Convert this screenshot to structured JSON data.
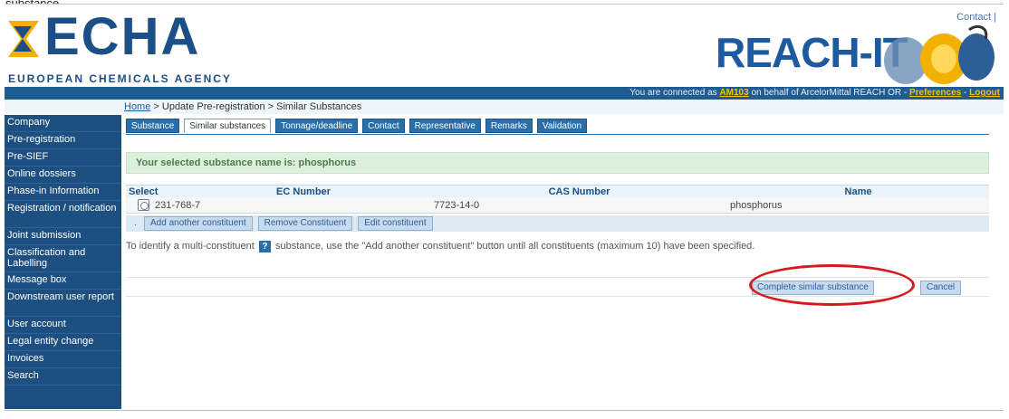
{
  "page_caption": "substance",
  "header": {
    "logo_text": "ECHA",
    "logo_subtitle": "EUROPEAN CHEMICALS AGENCY",
    "app_name": "REACH-IT",
    "contact_label": "Contact |"
  },
  "status_bar": {
    "prefix": "You are connected as ",
    "user": "AM103",
    "middle": " on behalf of ArcelorMittal REACH OR - ",
    "preferences": "Preferences",
    "separator": " - ",
    "logout": "Logout"
  },
  "breadcrumb": {
    "home": "Home",
    "rest": " > Update Pre-registration > Similar Substances"
  },
  "sidebar": {
    "items": [
      {
        "label": "Company"
      },
      {
        "label": "Pre-registration"
      },
      {
        "label": "Pre-SIEF"
      },
      {
        "label": "Online dossiers"
      },
      {
        "label": "Phase-in Information"
      },
      {
        "label": "Registration / notification"
      },
      {
        "label": "Joint submission"
      },
      {
        "label": "Classification and Labelling"
      },
      {
        "label": "Message box"
      },
      {
        "label": "Downstream user report"
      },
      {
        "label": "User account"
      },
      {
        "label": "Legal entity change"
      },
      {
        "label": "Invoices"
      },
      {
        "label": "Search"
      }
    ]
  },
  "tabs": [
    {
      "label": "Substance"
    },
    {
      "label": "Similar substances"
    },
    {
      "label": "Tonnage/deadline"
    },
    {
      "label": "Contact"
    },
    {
      "label": "Representative"
    },
    {
      "label": "Remarks"
    },
    {
      "label": "Validation"
    }
  ],
  "selected_banner": "Your selected substance name is: phosphorus",
  "grid": {
    "headers": {
      "select": "Select",
      "ec": "EC Number",
      "cas": "CAS Number",
      "name": "Name"
    },
    "rows": [
      {
        "ec": "231-768-7",
        "cas": "7723-14-0",
        "name": "phosphorus"
      }
    ]
  },
  "constituent_actions": {
    "bullet": ".",
    "add": "Add another constituent",
    "remove": "Remove Constituent",
    "edit": "Edit constituent"
  },
  "help": {
    "before": "To identify a multi-constituent ",
    "icon": "?",
    "after": " substance, use the \"Add another constituent\" button until all constituents (maximum 10) have been specified."
  },
  "actions": {
    "complete": "Complete similar substance",
    "cancel": "Cancel"
  },
  "colors": {
    "brand_blue": "#1d4f80",
    "highlight_ring": "#d8191c"
  }
}
